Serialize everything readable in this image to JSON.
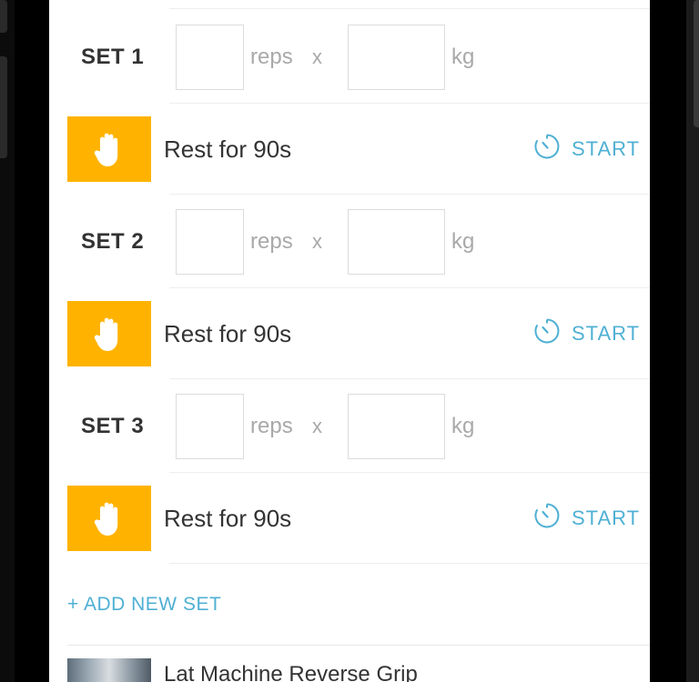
{
  "sets": [
    {
      "label": "SET 1",
      "reps_unit": "reps",
      "times": "x",
      "weight_unit": "kg",
      "rest_text": "Rest for 90s",
      "start_label": "START"
    },
    {
      "label": "SET 2",
      "reps_unit": "reps",
      "times": "x",
      "weight_unit": "kg",
      "rest_text": "Rest for 90s",
      "start_label": "START"
    },
    {
      "label": "SET 3",
      "reps_unit": "reps",
      "times": "x",
      "weight_unit": "kg",
      "rest_text": "Rest for 90s",
      "start_label": "START"
    }
  ],
  "add_set_label": "+ ADD NEW SET",
  "next_exercise": {
    "name": "Lat Machine Reverse Grip"
  },
  "icons": {
    "rest": "hand-icon",
    "start": "timer-icon"
  },
  "colors": {
    "accent": "#4fb0d4",
    "rest_badge": "#ffb300"
  }
}
